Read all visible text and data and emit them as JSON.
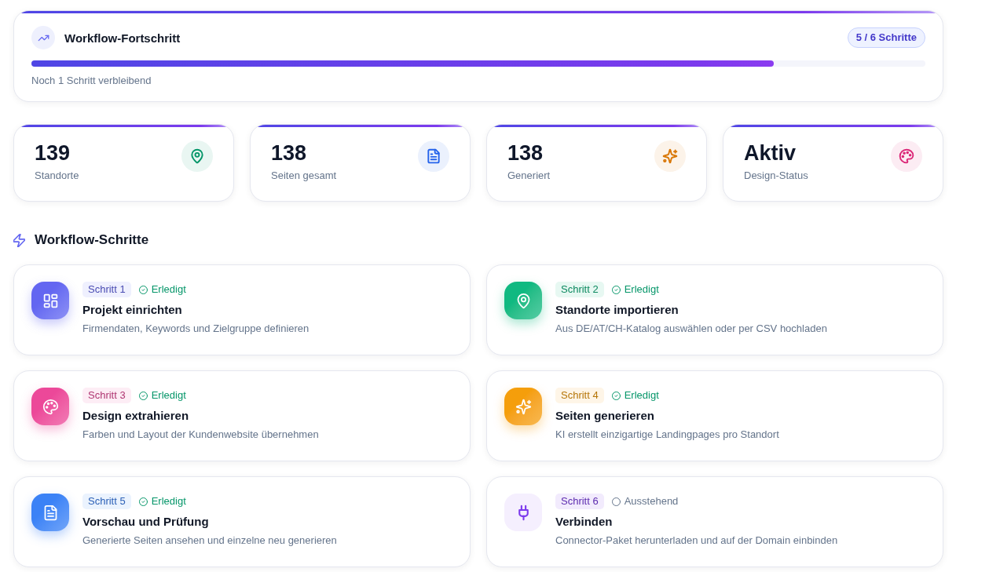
{
  "progress": {
    "title": "Workflow-Fortschritt",
    "badge": "5 / 6 Schritte",
    "level": 0.83,
    "remaining": "Noch 1 Schritt verbleibend"
  },
  "stats": [
    {
      "value": "139",
      "label": "Standorte",
      "color": "#059669"
    },
    {
      "value": "138",
      "label": "Seiten gesamt",
      "color": "#2563eb"
    },
    {
      "value": "138",
      "label": "Generiert",
      "color": "#d97706"
    },
    {
      "value": "Aktiv",
      "label": "Design-Status",
      "color": "#db2777"
    }
  ],
  "steps_section": {
    "title": "Workflow-Schritte"
  },
  "steps": [
    {
      "badge": "Schritt 1",
      "status": "Erledigt",
      "completed": true,
      "title": "Projekt einrichten",
      "description": "Firmendaten, Keywords und Zielgruppe definieren",
      "color": "#6366f1"
    },
    {
      "badge": "Schritt 2",
      "status": "Erledigt",
      "completed": true,
      "title": "Standorte importieren",
      "description": "Aus DE/AT/CH-Katalog auswählen oder per CSV hochladen",
      "color": "#10b981"
    },
    {
      "badge": "Schritt 3",
      "status": "Erledigt",
      "completed": true,
      "title": "Design extrahieren",
      "description": "Farben und Layout der Kundenwebsite übernehmen",
      "color": "#ec4899"
    },
    {
      "badge": "Schritt 4",
      "status": "Erledigt",
      "completed": true,
      "title": "Seiten generieren",
      "description": "KI erstellt einzigartige Landingpages pro Standort",
      "color": "#f59e0b"
    },
    {
      "badge": "Schritt 5",
      "status": "Erledigt",
      "completed": true,
      "title": "Vorschau und Prüfung",
      "description": "Generierte Seiten ansehen und einzelne neu generieren",
      "color": "#3b82f6"
    },
    {
      "badge": "Schritt 6",
      "status": "Ausstehend",
      "completed": false,
      "title": "Verbinden",
      "description": "Connector-Paket herunterladen und auf der Domain einbinden",
      "color": "#7c3aed"
    }
  ]
}
